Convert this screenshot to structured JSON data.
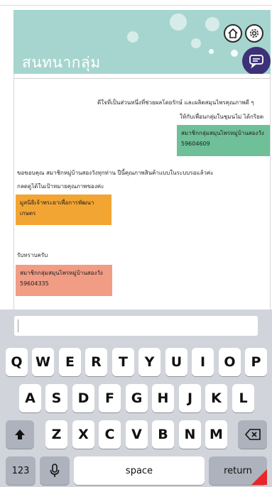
{
  "header": {
    "title": "สนทนากลุ่ม",
    "home_icon": "home-icon",
    "settings_icon": "gear-icon",
    "chat_icon": "chat-bubble-icon"
  },
  "messages": {
    "intro_line1": "ดีใจที่เป็นส่วนหนึ่งที่ช่วยผลโดยรักษ์ และผลิตสมุนไพรคุณภาพดี ๆ",
    "intro_line2": "ให้กับเพื่อนกลุ่มในชุมนไม่ ได้กริยต",
    "green_line1": "สมาชิกกลุ่มสมุนไพรหมู่บ้านสองวัง",
    "green_line2": "59604609",
    "thanks_line1": "ขอขอบคุณ สมาชิกหมู่บ้านสองวังทุกท่าน ปีนี้คุณภาพสินค้าแบบในระบบรอแล้วค่ะ",
    "thanks_line2": "กลดดูได้ในเป้าหมายคุณภาพของค่ะ",
    "orange_line1": "มูลนิธิเจ้าพระยาเพื่อการพัฒนาเกษตร",
    "received": "รับทราบครับ",
    "pink_line1": "สมาชิกกลุ่มสมุนไพรหมู่บ้านสองวัง",
    "pink_line2": "59604335"
  },
  "input": {
    "value": ""
  },
  "keyboard": {
    "row1": [
      "Q",
      "W",
      "E",
      "R",
      "T",
      "Y",
      "U",
      "I",
      "O",
      "P"
    ],
    "row2": [
      "A",
      "S",
      "D",
      "F",
      "G",
      "H",
      "J",
      "K",
      "L"
    ],
    "row3": [
      "Z",
      "X",
      "C",
      "V",
      "B",
      "N",
      "M"
    ],
    "numbers_label": "123",
    "space_label": "space",
    "return_label": "return",
    "shift_icon": "shift-icon",
    "backspace_icon": "backspace-icon",
    "mic_icon": "microphone-icon"
  },
  "colors": {
    "header_bg": "#a6d5cf",
    "chat_button": "#3d3178",
    "green_message": "#6fbf98",
    "orange_message": "#f3a533",
    "pink_message": "#f19c85"
  }
}
